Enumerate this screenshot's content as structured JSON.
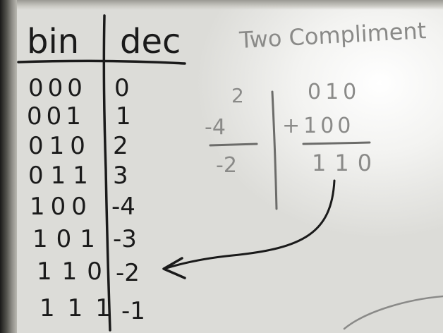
{
  "whiteboard": {
    "header_bin": "bin",
    "header_dec": "dec",
    "title": "Two Compliment",
    "rows": [
      {
        "bin": "000",
        "dec": "0"
      },
      {
        "bin": "001",
        "dec": "1"
      },
      {
        "bin": "010",
        "dec": "2"
      },
      {
        "bin": "011",
        "dec": "3"
      },
      {
        "bin": "100",
        "dec": "-4"
      },
      {
        "bin": "101",
        "dec": "-3"
      },
      {
        "bin": "110",
        "dec": "-2"
      },
      {
        "bin": "111",
        "dec": "-1"
      }
    ],
    "decimal_sum": {
      "a": "2",
      "b": "-4",
      "result": "-2"
    },
    "binary_sum": {
      "a": "010",
      "b": "+100",
      "result": "110"
    },
    "ink_color": "#1a1a1a",
    "title_color": "#8a8a88"
  }
}
